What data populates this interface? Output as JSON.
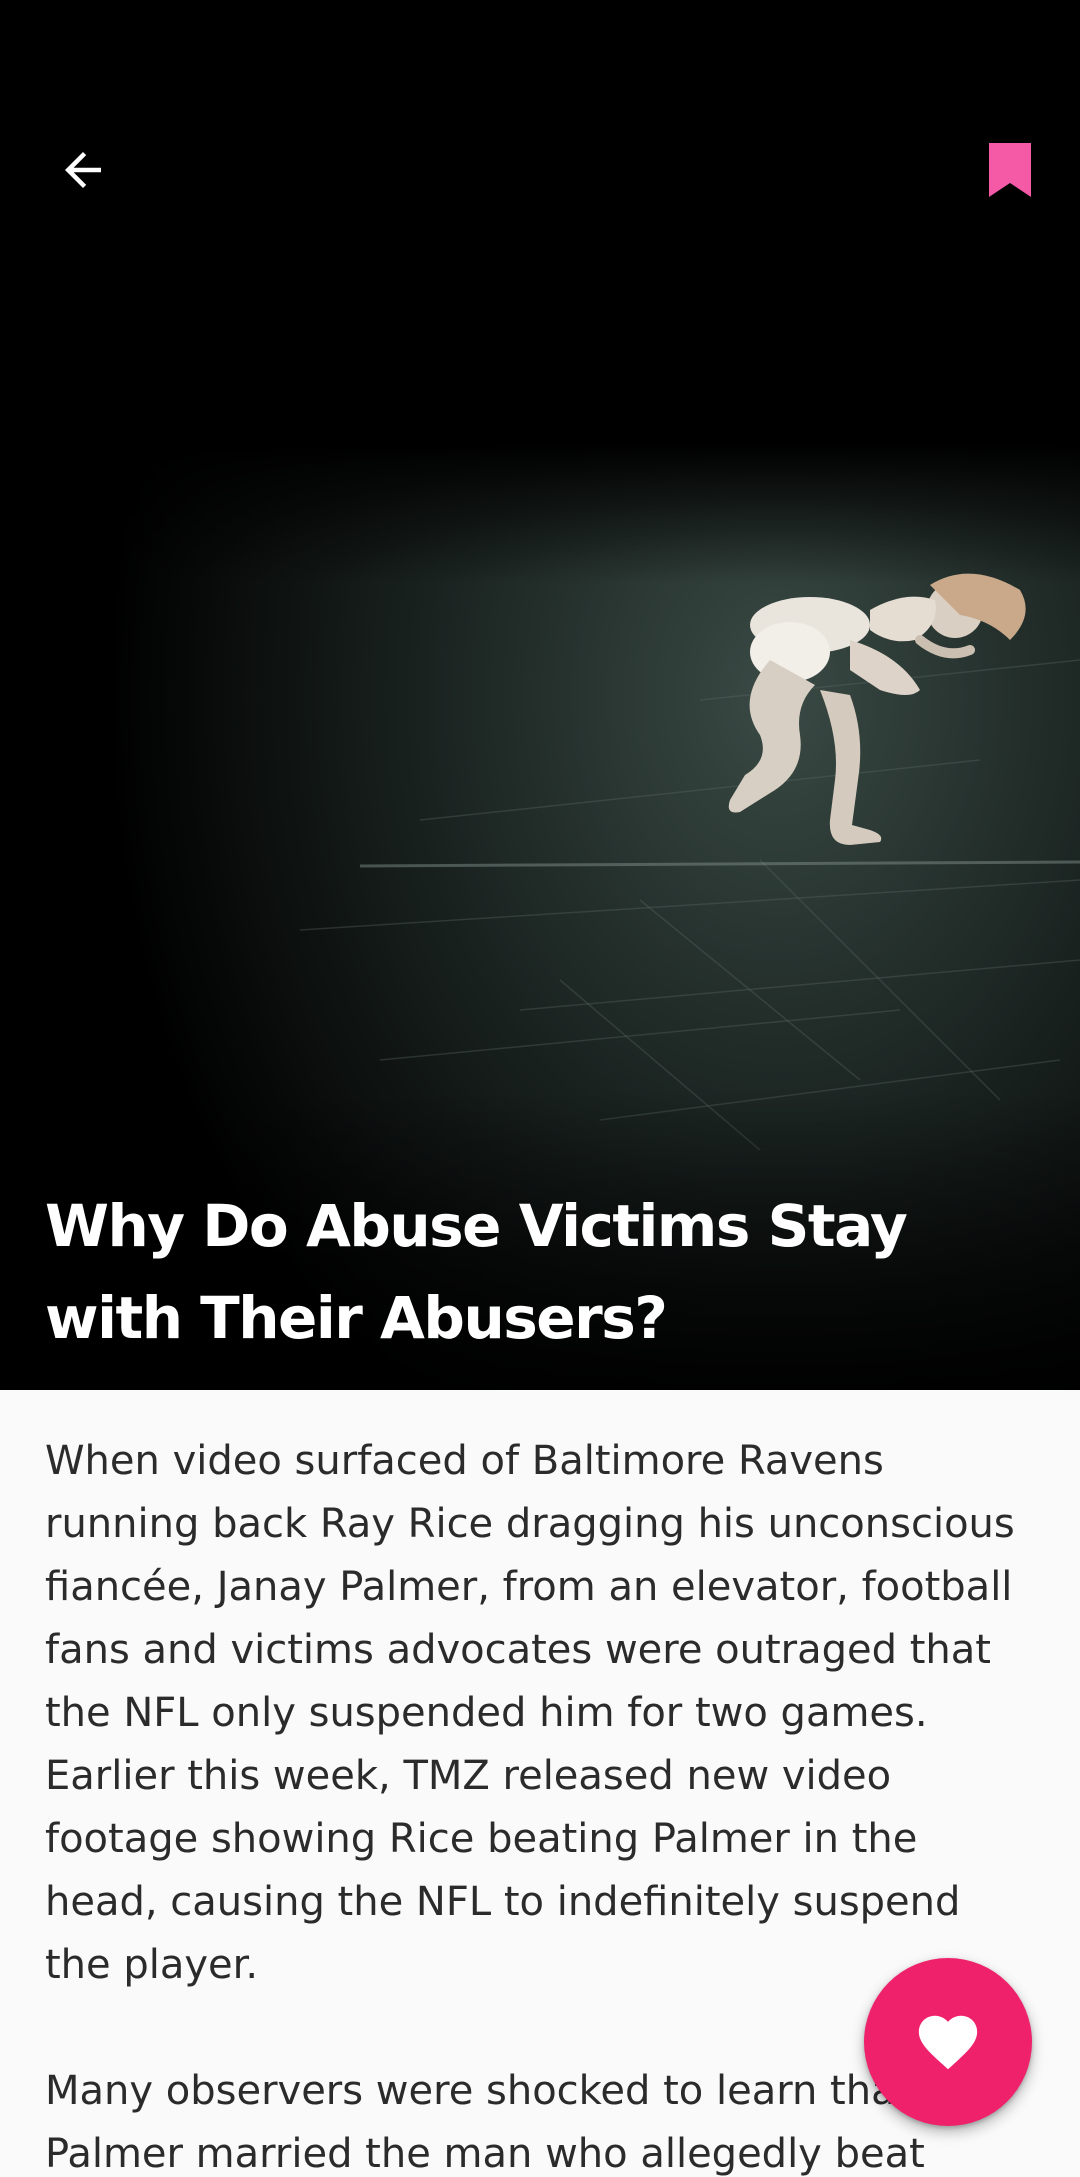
{
  "colors": {
    "accent": "#f0216b",
    "bookmark": "#f45aa6",
    "title_text": "#ffffff",
    "body_text": "#2b2b2b",
    "page_background": "#fafafa"
  },
  "toolbar": {
    "back_icon": "arrow-left-icon",
    "bookmark_icon": "bookmark-icon"
  },
  "hero": {
    "image_subject": "dancer lying curled on a dark stage floor"
  },
  "article": {
    "title": "Why Do Abuse Victims Stay with Their Abusers?",
    "paragraphs": [
      "When video surfaced of Baltimore Ravens running back Ray Rice dragging his unconscious fiancée, Janay Palmer, from an elevator, football fans and victims advocates were outraged that the NFL only suspended him for two games. Earlier this week, TMZ released new video footage showing Rice beating Palmer in the head, causing the NFL to indefinitely suspend the player.",
      "Many observers were shocked to learn that Palmer married the man who allegedly beat"
    ]
  },
  "fab": {
    "icon": "heart-icon"
  }
}
